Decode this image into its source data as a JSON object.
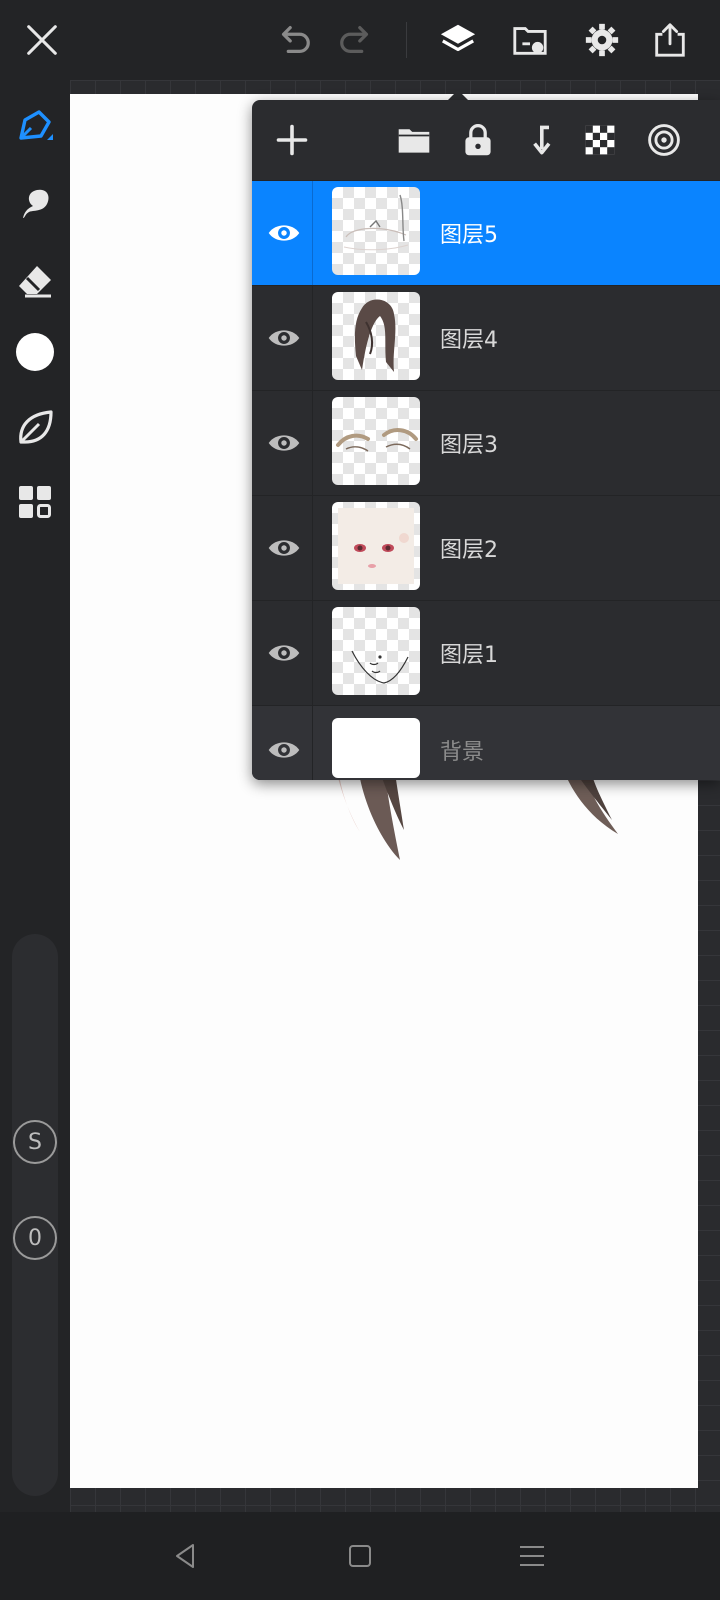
{
  "colors": {
    "accent": "#0a84ff",
    "panel_bg": "#2b2c2f",
    "toolbar_bg": "#232426"
  },
  "topbar": {
    "icons": [
      "close-icon",
      "undo-icon",
      "redo-icon",
      "layers-icon",
      "import-icon",
      "settings-icon",
      "share-icon"
    ]
  },
  "lefttools": {
    "icons": [
      "pen-icon",
      "smudge-icon",
      "eraser-icon",
      "color-icon",
      "leaf-icon",
      "grid-icon"
    ],
    "size_label": "S",
    "opacity_label": "0"
  },
  "layers_panel": {
    "toolbar_icons": [
      "add-layer-icon",
      "folder-icon",
      "lock-icon",
      "merge-down-icon",
      "alpha-lock-icon",
      "more-icon"
    ],
    "layers": [
      {
        "name": "图层5",
        "selected": true
      },
      {
        "name": "图层4",
        "selected": false
      },
      {
        "name": "图层3",
        "selected": false
      },
      {
        "name": "图层2",
        "selected": false
      },
      {
        "name": "图层1",
        "selected": false
      }
    ],
    "background": {
      "name": "背景"
    }
  },
  "navbar": {
    "icons": [
      "back-icon",
      "home-icon",
      "recents-icon"
    ]
  }
}
